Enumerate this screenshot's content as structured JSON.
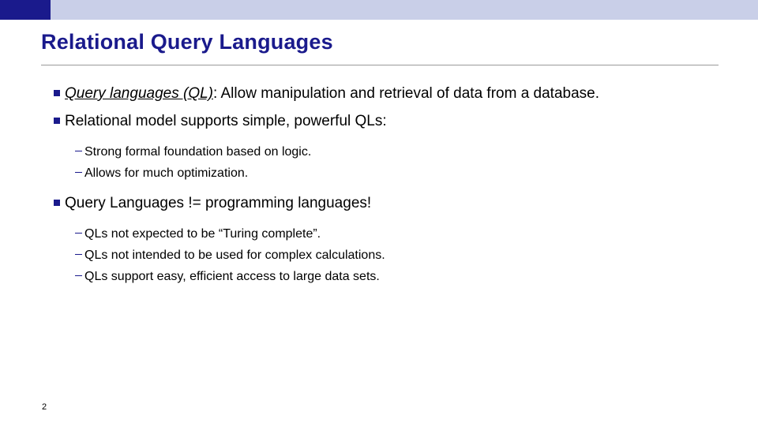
{
  "slide": {
    "title": "Relational Query Languages",
    "page_number": "2",
    "accent_color": "#1a1a8c",
    "band_color": "#c9cfe8",
    "bullets": [
      {
        "level": 1,
        "marker": "square-bullet",
        "lead": "Query languages (QL)",
        "rest": ":  Allow manipulation and retrieval of data from a database."
      },
      {
        "level": 1,
        "marker": "square-bullet",
        "text": "Relational model supports simple, powerful QLs:"
      },
      {
        "level": 2,
        "marker": "dash-bullet",
        "text": "Strong formal foundation based on logic."
      },
      {
        "level": 2,
        "marker": "dash-bullet",
        "text": "Allows for much optimization."
      },
      {
        "level": 1,
        "marker": "square-bullet",
        "text": "Query Languages != programming languages!"
      },
      {
        "level": 2,
        "marker": "dash-bullet",
        "text": "QLs not expected to be “Turing complete”."
      },
      {
        "level": 2,
        "marker": "dash-bullet",
        "text": "QLs not intended to be used for complex calculations."
      },
      {
        "level": 2,
        "marker": "dash-bullet",
        "text": "QLs support easy, efficient access to large data sets."
      }
    ]
  }
}
